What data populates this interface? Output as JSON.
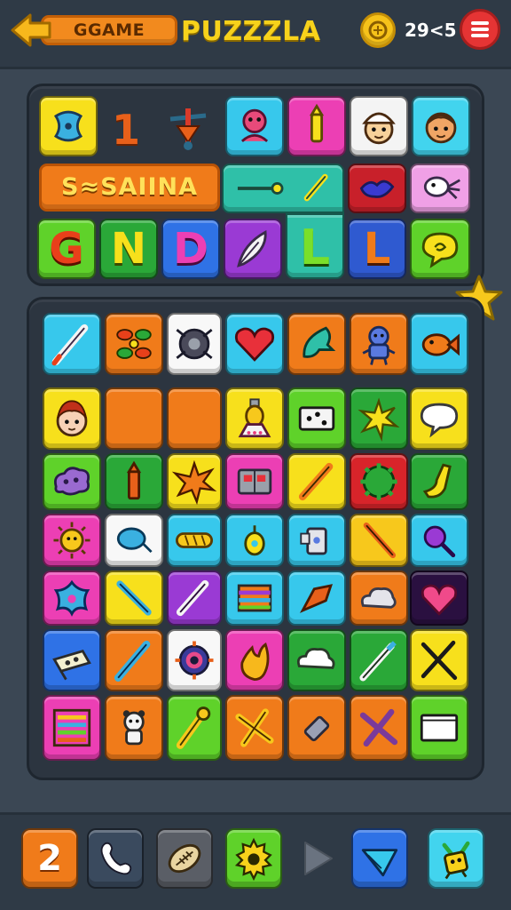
{
  "header": {
    "back_label": "GGAME",
    "title": "PUZZZLA",
    "coins": "29<5",
    "icons": [
      "back-arrow-icon",
      "coin-icon",
      "menu-icon"
    ]
  },
  "top_panel": {
    "banner_text": "S≈SAIINA",
    "number_tile": "1",
    "letters": [
      "G",
      "N",
      "D",
      "L",
      "L"
    ]
  },
  "toolbar": {
    "first_tool_count": "2",
    "icons": [
      "phone-icon",
      "football-icon",
      "gear-icon",
      "play-icon",
      "dustpan-icon",
      "robot-icon"
    ]
  },
  "colors": {
    "background": "#3b4754",
    "panel": "#2c3540",
    "title": "#f7d21b",
    "accent_orange": "#f07b1a",
    "menu_red": "#e53434"
  }
}
